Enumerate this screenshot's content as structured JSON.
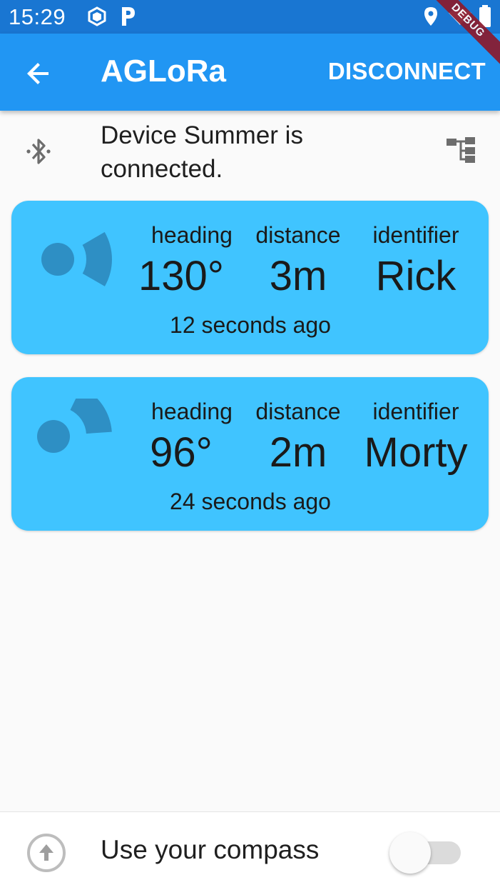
{
  "status_bar": {
    "time": "15:29",
    "icons": [
      "storage-icon",
      "parking-p-icon",
      "location-icon",
      "wifi-icon",
      "battery-icon"
    ],
    "debug_label": "DEBUG"
  },
  "app_bar": {
    "title": "AGLoRa",
    "action_label": "DISCONNECT",
    "back_icon": "arrow-back-icon"
  },
  "device": {
    "status_text": "Device Summer is connected.",
    "left_icon": "bluetooth-icon",
    "right_icon": "device-tree-icon"
  },
  "cards": [
    {
      "heading_label": "heading",
      "distance_label": "distance",
      "identifier_label": "identifier",
      "heading": "130°",
      "distance": "3m",
      "identifier": "Rick",
      "time_ago": "12 seconds ago",
      "direction_deg": 130
    },
    {
      "heading_label": "heading",
      "distance_label": "distance",
      "identifier_label": "identifier",
      "heading": "96°",
      "distance": "2m",
      "identifier": "Morty",
      "time_ago": "24 seconds ago",
      "direction_deg": 96
    }
  ],
  "bottom": {
    "label": "Use your compass",
    "toggle_on": false,
    "icon": "compass-arrow-up-icon"
  },
  "colors": {
    "status_bar": "#1976d2",
    "app_bar": "#2196f3",
    "card": "#40c4ff",
    "card_icon": "#2e8fc4"
  }
}
